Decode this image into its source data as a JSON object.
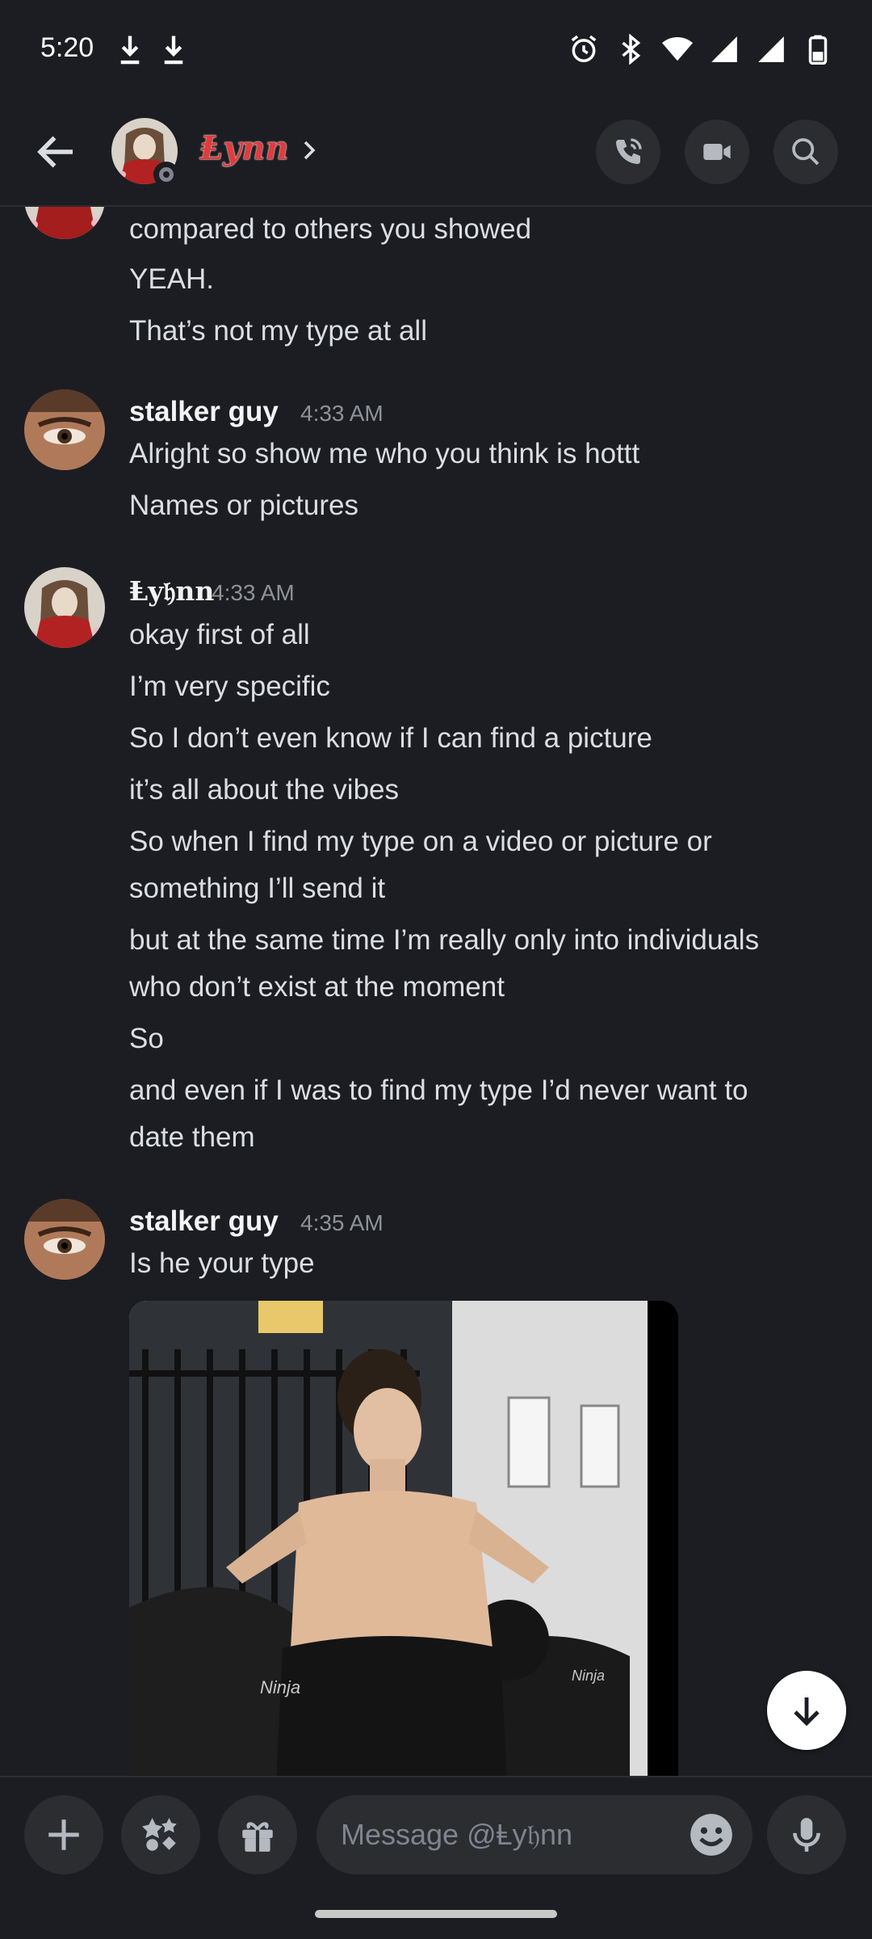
{
  "status_bar": {
    "time": "5:20"
  },
  "header": {
    "title": "Ⱡynn"
  },
  "messages": {
    "continued": [
      "compared to others you showed",
      "YEAH.",
      "That’s not my type at all"
    ],
    "group1": {
      "author": "stalker guy",
      "time": "4:33 AM",
      "lines": [
        "Alright so show me who you think is hottt",
        "Names or pictures"
      ]
    },
    "group2": {
      "author": "Ⱡy𝔥nn",
      "time": "4:33 AM",
      "lines": [
        "okay first of all",
        "I’m very specific",
        "So I don’t even know if I can find a picture",
        "it’s all about the vibes",
        "So when I find my type on a video or picture or",
        "something I’ll send it",
        "but at the same time I’m really only into individuals",
        "who don’t exist at the moment",
        "So",
        "and even if I was to find my type I’d never want to",
        "date them"
      ]
    },
    "group3": {
      "author": "stalker guy",
      "time": "4:35 AM",
      "lines": [
        "Is he your type"
      ],
      "image_text": [
        "Ninja",
        "Ninja"
      ]
    }
  },
  "composer": {
    "placeholder": "Message @Ⱡy𝔥nn"
  },
  "colors": {
    "background": "#1c1d22",
    "surface": "#2b2d31",
    "text": "#dbdee1",
    "muted": "#8e9297",
    "title_red": "#e23b3b"
  },
  "icons": [
    "download-icon",
    "alarm-icon",
    "bluetooth-icon",
    "wifi-icon",
    "signal-icon",
    "battery-icon",
    "back-arrow-icon",
    "chevron-right-icon",
    "voice-call-icon",
    "video-call-icon",
    "search-icon",
    "scroll-down-icon",
    "plus-icon",
    "apps-icon",
    "gift-icon",
    "emoji-icon",
    "microphone-icon"
  ]
}
